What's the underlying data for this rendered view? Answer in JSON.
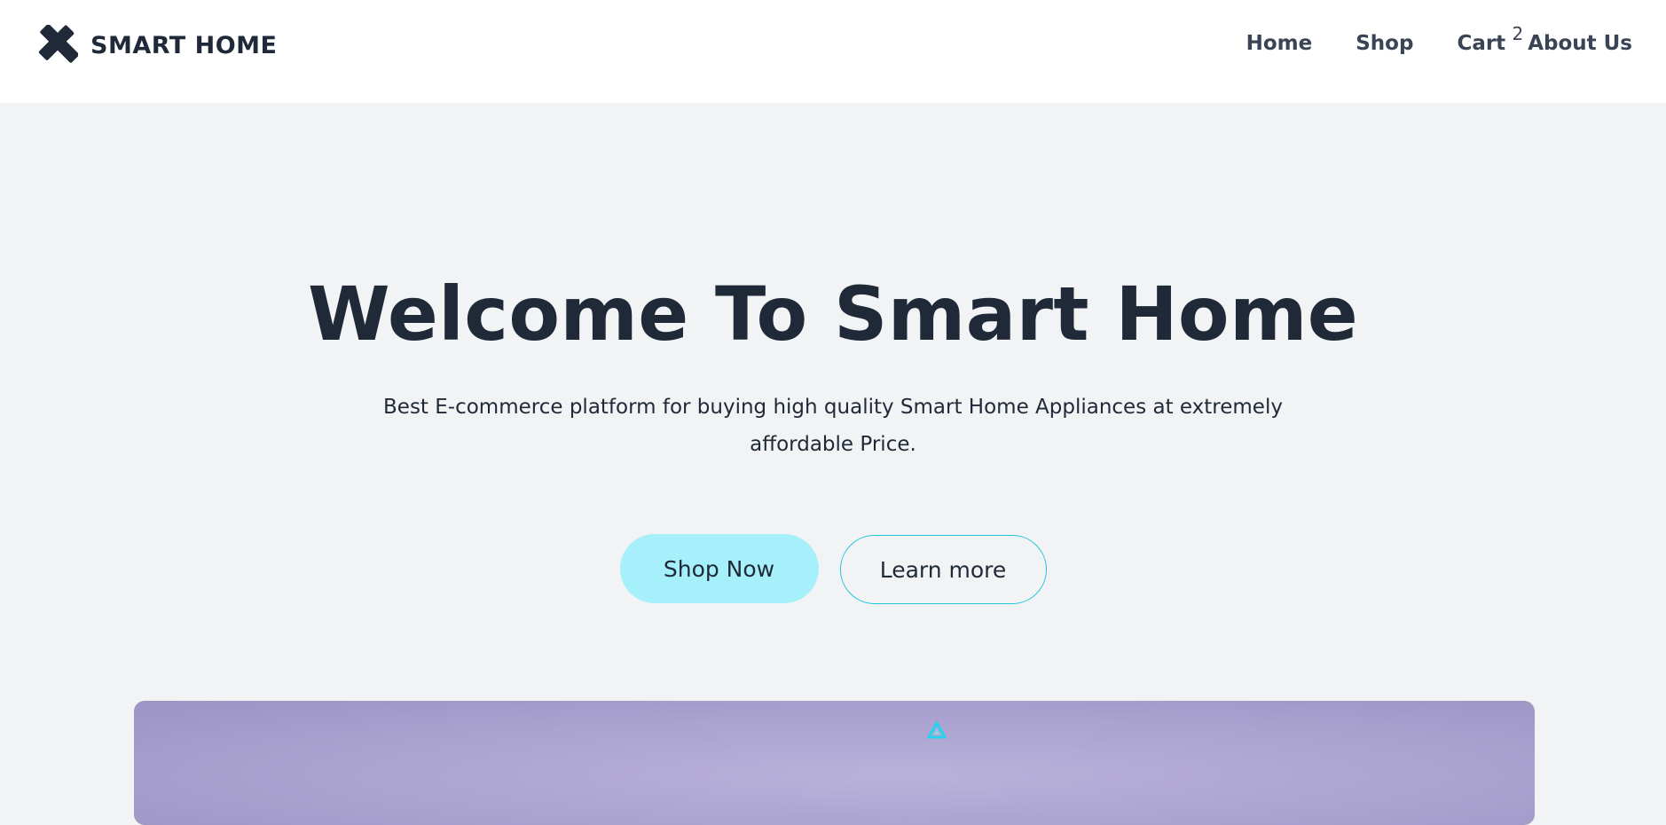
{
  "header": {
    "brand_name": "SMART HOME",
    "brand_icon": "x-logo-icon",
    "nav": {
      "home": "Home",
      "shop": "Shop",
      "cart": "Cart",
      "cart_count": "2",
      "about": "About Us"
    }
  },
  "hero": {
    "title": "Welcome To Smart Home",
    "subtitle": "Best E-commerce platform for buying high quality Smart Home Appliances at extremely affordable Price.",
    "primary_button": "Shop Now",
    "secondary_button": "Learn more"
  },
  "showcase": {
    "icon": "triangle-icon"
  },
  "colors": {
    "text": "#1f2937",
    "nav_text": "#3b4454",
    "background": "#f2f3f5",
    "primary_button": "#a5f0fa",
    "outline_border": "#22c5dc",
    "showcase_gradient_center": "#b9b2da",
    "showcase_gradient_edge": "#9b94c4",
    "accent_icon": "#22d3ee"
  }
}
